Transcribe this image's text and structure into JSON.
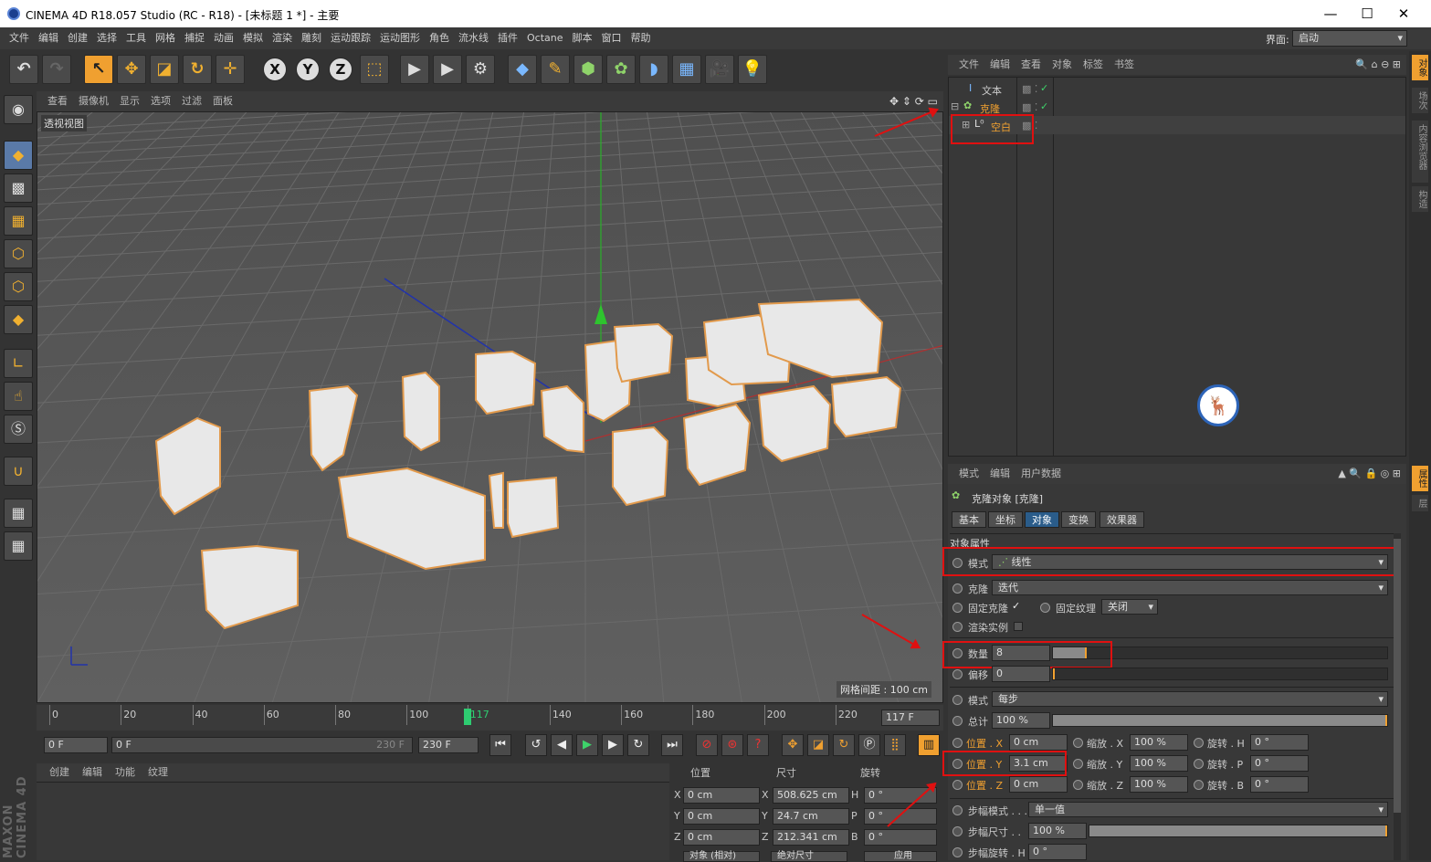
{
  "window": {
    "title": "CINEMA 4D R18.057 Studio (RC - R18) - [未标题 1 *] - 主要",
    "minimize": "—",
    "maximize": "☐",
    "close": "✕"
  },
  "menubar": {
    "items": [
      "文件",
      "编辑",
      "创建",
      "选择",
      "工具",
      "网格",
      "捕捉",
      "动画",
      "模拟",
      "渲染",
      "雕刻",
      "运动跟踪",
      "运动图形",
      "角色",
      "流水线",
      "插件",
      "Octane",
      "脚本",
      "窗口",
      "帮助"
    ],
    "layout_label": "界面:",
    "layout_value": "启动"
  },
  "toolbar": {
    "icons": [
      "undo-icon",
      "redo-icon",
      "live-select-icon",
      "move-icon",
      "scale-icon",
      "rotate-icon",
      "transform-icon",
      "x-axis-icon",
      "y-axis-icon",
      "z-axis-icon",
      "coord-system-icon",
      "render-view-icon",
      "render-picture-viewer-icon",
      "edit-render-settings-icon",
      "cube-icon",
      "pen-icon",
      "subdivision-icon",
      "mograph-cloner-icon",
      "deformer-icon",
      "floor-icon",
      "camera-icon",
      "light-icon"
    ]
  },
  "viewport": {
    "menu": [
      "查看",
      "摄像机",
      "显示",
      "选项",
      "过滤",
      "面板"
    ],
    "label": "透视视图",
    "grid_spacing": "网格间距 : 100 cm"
  },
  "timeline": {
    "ticks": [
      "0",
      "20",
      "40",
      "60",
      "80",
      "100",
      "117",
      "140",
      "160",
      "180",
      "200",
      "220"
    ],
    "current": "117",
    "end_field": "117 F"
  },
  "playback": {
    "start": "0 F",
    "range_start": "0 F",
    "range_end": "230 F",
    "end": "230 F"
  },
  "material": {
    "menu": [
      "创建",
      "编辑",
      "功能",
      "纹理"
    ]
  },
  "coordinates": {
    "headers": [
      "位置",
      "尺寸",
      "旋转"
    ],
    "rows": [
      {
        "axis": "X",
        "pos": "0 cm",
        "size_axis": "X",
        "size": "508.625 cm",
        "rot_axis": "H",
        "rot": "0 °"
      },
      {
        "axis": "Y",
        "pos": "0 cm",
        "size_axis": "Y",
        "size": "24.7 cm",
        "rot_axis": "P",
        "rot": "0 °"
      },
      {
        "axis": "Z",
        "pos": "0 cm",
        "size_axis": "Z",
        "size": "212.341 cm",
        "rot_axis": "B",
        "rot": "0 °"
      }
    ],
    "mode": "对象 (相对)",
    "size_mode": "绝对尺寸",
    "apply": "应用"
  },
  "object_manager": {
    "menu": [
      "文件",
      "编辑",
      "查看",
      "对象",
      "标签",
      "书签"
    ],
    "objects": [
      {
        "name": "文本",
        "indent": 0
      },
      {
        "name": "克隆",
        "indent": 0
      },
      {
        "name": "空白",
        "indent": 1
      }
    ]
  },
  "right_tabs_top": [
    "对象",
    "场次",
    "内容浏览器",
    "构造"
  ],
  "right_tabs_bottom": [
    "属性",
    "层"
  ],
  "attributes": {
    "menu": [
      "模式",
      "编辑",
      "用户数据"
    ],
    "object_title": "克隆对象 [克隆]",
    "tabs": [
      "基本",
      "坐标",
      "对象",
      "变换",
      "效果器"
    ],
    "active_tab": "对象",
    "section": "对象属性",
    "mode_label": "模式",
    "mode_value": "线性",
    "clone_label": "克隆",
    "clone_value": "迭代",
    "fix_clone_label": "固定克隆",
    "fix_clone_check": "✓",
    "fix_texture_label": "固定纹理",
    "fix_texture_value": "关闭",
    "render_instance_label": "渲染实例",
    "count_label": "数量",
    "count_value": "8",
    "count_fill": 0.1,
    "offset_label": "偏移",
    "offset_value": "0",
    "mode2_label": "模式",
    "mode2_value": "每步",
    "total_label": "总计",
    "total_value": "100 %",
    "total_fill": 1.0,
    "pos_x_label": "位置 . X",
    "pos_x": "0 cm",
    "scale_x_label": "缩放 . X",
    "scale_x": "100 %",
    "rot_h_label": "旋转 . H",
    "rot_h": "0 °",
    "pos_y_label": "位置 . Y",
    "pos_y": "3.1 cm",
    "scale_y_label": "缩放 . Y",
    "scale_y": "100 %",
    "rot_p_label": "旋转 . P",
    "rot_p": "0 °",
    "pos_z_label": "位置 . Z",
    "pos_z": "0 cm",
    "scale_z_label": "缩放 . Z",
    "scale_z": "100 %",
    "rot_b_label": "旋转 . B",
    "rot_b": "0 °",
    "step_mode_label": "步幅模式 . . .",
    "step_mode_value": "单一值",
    "step_size_label": "步幅尺寸 . .",
    "step_size_value": "100 %",
    "step_rot_label": "步幅旋转 . H",
    "step_rot_value": "0 °"
  },
  "colors": {
    "accent": "#f0a030",
    "highlight_box": "#e01010",
    "active_tab": "#2a5c8a"
  }
}
